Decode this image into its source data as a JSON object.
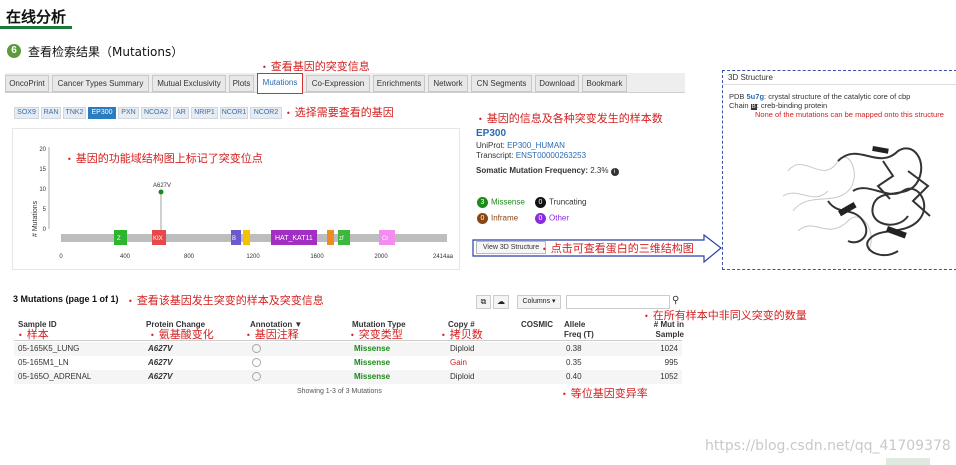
{
  "slide": {
    "title": "在线分析",
    "step_number": "6",
    "step_text": "查看检索结果（Mutations）"
  },
  "tabs": [
    "OncoPrint",
    "Cancer Types Summary",
    "Mutual Exclusivity",
    "Plots",
    "Mutations",
    "Co-Expression",
    "Enrichments",
    "Network",
    "CN Segments",
    "Download",
    "Bookmark"
  ],
  "active_tab": "Mutations",
  "genes": [
    "SOX9",
    "RAN",
    "TNK2",
    "EP300",
    "PXN",
    "NCOA2",
    "AR",
    "NRIP1",
    "NCOR1",
    "NCOR2"
  ],
  "active_gene": "EP300",
  "annotations": {
    "tab": "查看基因的突变信息",
    "genes": "选择需要查看的基因",
    "gene_info": "基因的信息及各种突变发生的样本数",
    "lollipop": "基因的功能域结构图上标记了突变位点",
    "view3d": "点击可查看蛋白的三维结构图",
    "table": "查看该基因发生突变的样本及突变信息",
    "mut_in_sample": "在所有样本中非同义突变的数量",
    "sample": "样本",
    "protein_change": "氨基酸变化",
    "annotation": "基因注释",
    "mutation_type": "突变类型",
    "copy": "拷贝数",
    "allele_freq": "等位基因变异率"
  },
  "plot": {
    "ylabel": "# Mutations",
    "yticks": [
      "0",
      "5",
      "10",
      "15",
      "20"
    ],
    "xticks": [
      "0",
      "400",
      "800",
      "1200",
      "1600",
      "2000",
      "2414aa"
    ],
    "mutation_label": "A627V",
    "domains": [
      "Z",
      "KIX",
      "B",
      "HAT_KAT11",
      "zf",
      "Cr"
    ]
  },
  "gene_info": {
    "name": "EP300",
    "uniprot_label": "UniProt:",
    "uniprot": "EP300_HUMAN",
    "transcript_label": "Transcript:",
    "transcript": "ENST00000263253",
    "freq_label": "Somatic Mutation Frequency:",
    "freq_value": "2.3%",
    "counts": [
      {
        "n": "3",
        "label": "Missense",
        "color": "#1a8a1a"
      },
      {
        "n": "0",
        "label": "Truncating",
        "color": "#111111"
      },
      {
        "n": "0",
        "label": "Inframe",
        "color": "#8b4513"
      },
      {
        "n": "0",
        "label": "Other",
        "color": "#8a2be2"
      }
    ],
    "view3d_button": "View 3D Structure"
  },
  "structure3d": {
    "title": "3D Structure",
    "pdb_label": "PDB",
    "pdb_id": "5u7g",
    "pdb_desc": ": crystal structure of the catalytic core of cbp",
    "chain_label": "Chain",
    "chain_id": "B",
    "chain_desc": ": creb-binding protein",
    "warning": "None of the mutations can be mapped onto this structure"
  },
  "table": {
    "title": "3 Mutations (page 1 of 1)",
    "columns_button": "Columns",
    "headers": [
      "Sample ID",
      "Protein Change",
      "Annotation ▼",
      "Mutation Type",
      "Copy #",
      "COSMIC",
      "Allele Freq (T)",
      "# Mut in Sample"
    ],
    "rows": [
      {
        "sample": "05-165K5_LUNG",
        "protein": "A627V",
        "type": "Missense",
        "copy": "Diploid",
        "freq": "0.38",
        "mut": "1024"
      },
      {
        "sample": "05-165M1_LN",
        "protein": "A627V",
        "type": "Missense",
        "copy": "Gain",
        "freq": "0.35",
        "mut": "995"
      },
      {
        "sample": "05-165O_ADRENAL",
        "protein": "A627V",
        "type": "Missense",
        "copy": "Diploid",
        "freq": "0.40",
        "mut": "1052"
      }
    ],
    "footer": "Showing 1-3 of 3 Mutations"
  },
  "watermark": "https://blog.csdn.net/qq_41709378"
}
